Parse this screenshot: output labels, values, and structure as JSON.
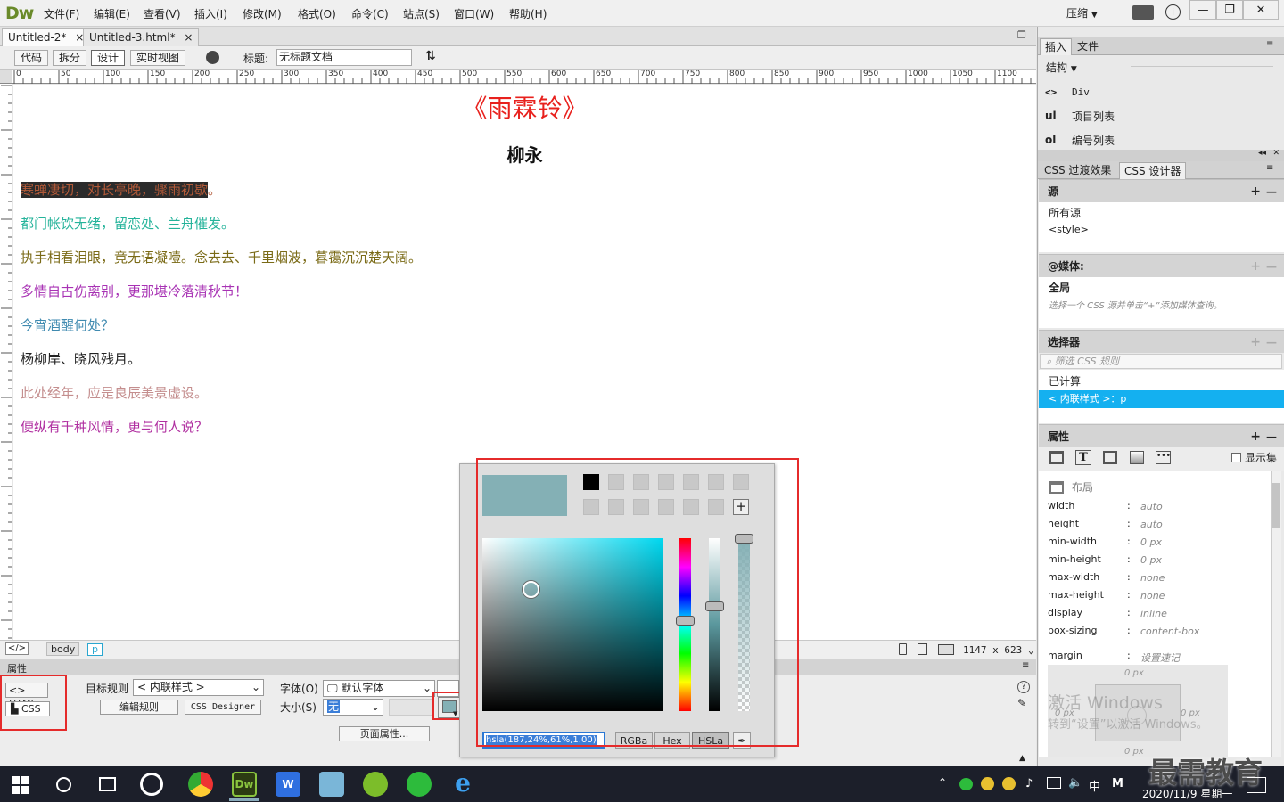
{
  "app": {
    "logo": "Dw",
    "menus": [
      "文件(F)",
      "编辑(E)",
      "查看(V)",
      "插入(I)",
      "修改(M)",
      "格式(O)",
      "命令(C)",
      "站点(S)",
      "窗口(W)",
      "帮助(H)"
    ],
    "layout_mode": "压缩"
  },
  "doc_tabs": [
    {
      "label": "Untitled-2*",
      "active": true
    },
    {
      "label": "Untitled-3.html*",
      "active": false
    }
  ],
  "toolbar": {
    "code": "代码",
    "split": "拆分",
    "design": "设计",
    "live": "实时视图",
    "title_label": "标题:",
    "title_value": "无标题文档"
  },
  "ruler_labels": [
    "0",
    "50",
    "100",
    "150",
    "200",
    "250",
    "300",
    "350",
    "400",
    "450",
    "500",
    "550",
    "600",
    "650",
    "700",
    "750",
    "800",
    "850",
    "900",
    "950",
    "1000",
    "1050",
    "1100"
  ],
  "poem": {
    "title": "《雨霖铃》",
    "author": "柳永",
    "lines": [
      {
        "text": "寒蝉凄切，对长亭晚，骤雨初歇",
        "tail": "。",
        "color": "#b25a39",
        "highlight": "#2b2b2b"
      },
      {
        "text": "都门帐饮无绪，留恋处、兰舟催发。",
        "color": "#24b39a"
      },
      {
        "text": "执手相看泪眼，竟无语凝噎。念去去、千里烟波，暮霭沉沉楚天阔。",
        "color": "#7a6a16"
      },
      {
        "text": "多情自古伤离别，更那堪冷落清秋节！",
        "color": "#a832b4"
      },
      {
        "text": "今宵酒醒何处？",
        "color": "#3f8ab0"
      },
      {
        "text": "杨柳岸、晓风残月。",
        "color": "#222222"
      },
      {
        "text": "此处经年，应是良辰美景虚设。",
        "color": "#c48e8e"
      },
      {
        "text": "便纵有千种风情，更与何人说？",
        "color": "#b02fa0"
      }
    ]
  },
  "status": {
    "tags": [
      "body",
      "p"
    ],
    "size": "1147 x 623"
  },
  "properties_panel": {
    "title": "属性",
    "html_btn": "HTML",
    "css_btn": "CSS",
    "target_rule_label": "目标规则",
    "target_rule_value": "< 内联样式 >",
    "edit_rule": "编辑规则",
    "css_designer": "CSS Designer",
    "font_label": "字体(O)",
    "font_value": "默认字体",
    "size_label": "大小(S)",
    "size_value": "无",
    "page_props": "页面属性..."
  },
  "color_picker": {
    "preview_color": "#84b0b5",
    "value": "hsla(187,24%,61%,1.00)",
    "modes": [
      "RGBa",
      "Hex",
      "HSLa"
    ],
    "active_mode": "HSLa"
  },
  "right_panel": {
    "top_tabs": [
      "插入",
      "文件"
    ],
    "structure_label": "结构",
    "insert_items": [
      {
        "icon": "<>",
        "label": "Div"
      },
      {
        "icon": "ul",
        "label": "项目列表"
      },
      {
        "icon": "ol",
        "label": "编号列表"
      }
    ],
    "css_tabs": [
      "CSS 过渡效果",
      "CSS 设计器"
    ],
    "source_label": "源",
    "sources": [
      "所有源",
      "<style>"
    ],
    "media_label": "@媒体:",
    "media_global": "全局",
    "media_hint": "选择一个 CSS 源并单击“+”添加媒体查询。",
    "selector_label": "选择器",
    "selector_filter": "筛选 CSS 规则",
    "computed": "已计算",
    "selected_rule": "< 内联样式 >：p",
    "properties_label": "属性",
    "show_set": "显示集",
    "layout_label": "布局",
    "props": [
      {
        "name": "width",
        "value": "auto"
      },
      {
        "name": "height",
        "value": "auto"
      },
      {
        "name": "min-width",
        "value": "0 px"
      },
      {
        "name": "min-height",
        "value": "0 px"
      },
      {
        "name": "max-width",
        "value": "none"
      },
      {
        "name": "max-height",
        "value": "none"
      },
      {
        "name": "display",
        "value": "inline"
      },
      {
        "name": "box-sizing",
        "value": "content-box"
      }
    ],
    "margin_label": "margin",
    "margin_value": "设置速记",
    "box_values": [
      "0 px",
      "0 px",
      "0 px",
      "0 px"
    ],
    "watermark_1": "激活 Windows",
    "watermark_2": "转到“设置”以激活 Windows。"
  },
  "taskbar": {
    "clock_date": "2020/11/9 星期一",
    "ime": "中",
    "brand": "最需教育"
  }
}
